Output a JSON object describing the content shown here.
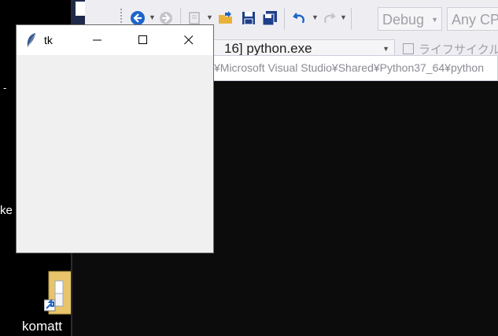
{
  "desktop": {
    "fragment_dash": "-",
    "fragment_ke": "ke",
    "shortcut_label": "komatt"
  },
  "vs": {
    "toolbar": {
      "config_combo": "Debug",
      "platform_combo": "Any CP"
    },
    "process_combo": "16] python.exe",
    "lifecycle_label": "ライフサイクル イ",
    "path_text": "¥Microsoft Visual Studio¥Shared¥Python37_64¥python"
  },
  "tk_window": {
    "title": "tk",
    "icons": {
      "app": "tk-feather-icon",
      "minimize": "minimize-icon",
      "maximize": "maximize-icon",
      "close": "close-icon"
    }
  },
  "colors": {
    "desktop_bg": "#000000",
    "vs_editor_bg": "#0c0c0c",
    "vs_toolbar_bg": "#eeeef2",
    "vs_navy": "#1f2a4a",
    "tk_client_bg": "#f0f0f0",
    "accent_blue": "#1e64c8"
  }
}
